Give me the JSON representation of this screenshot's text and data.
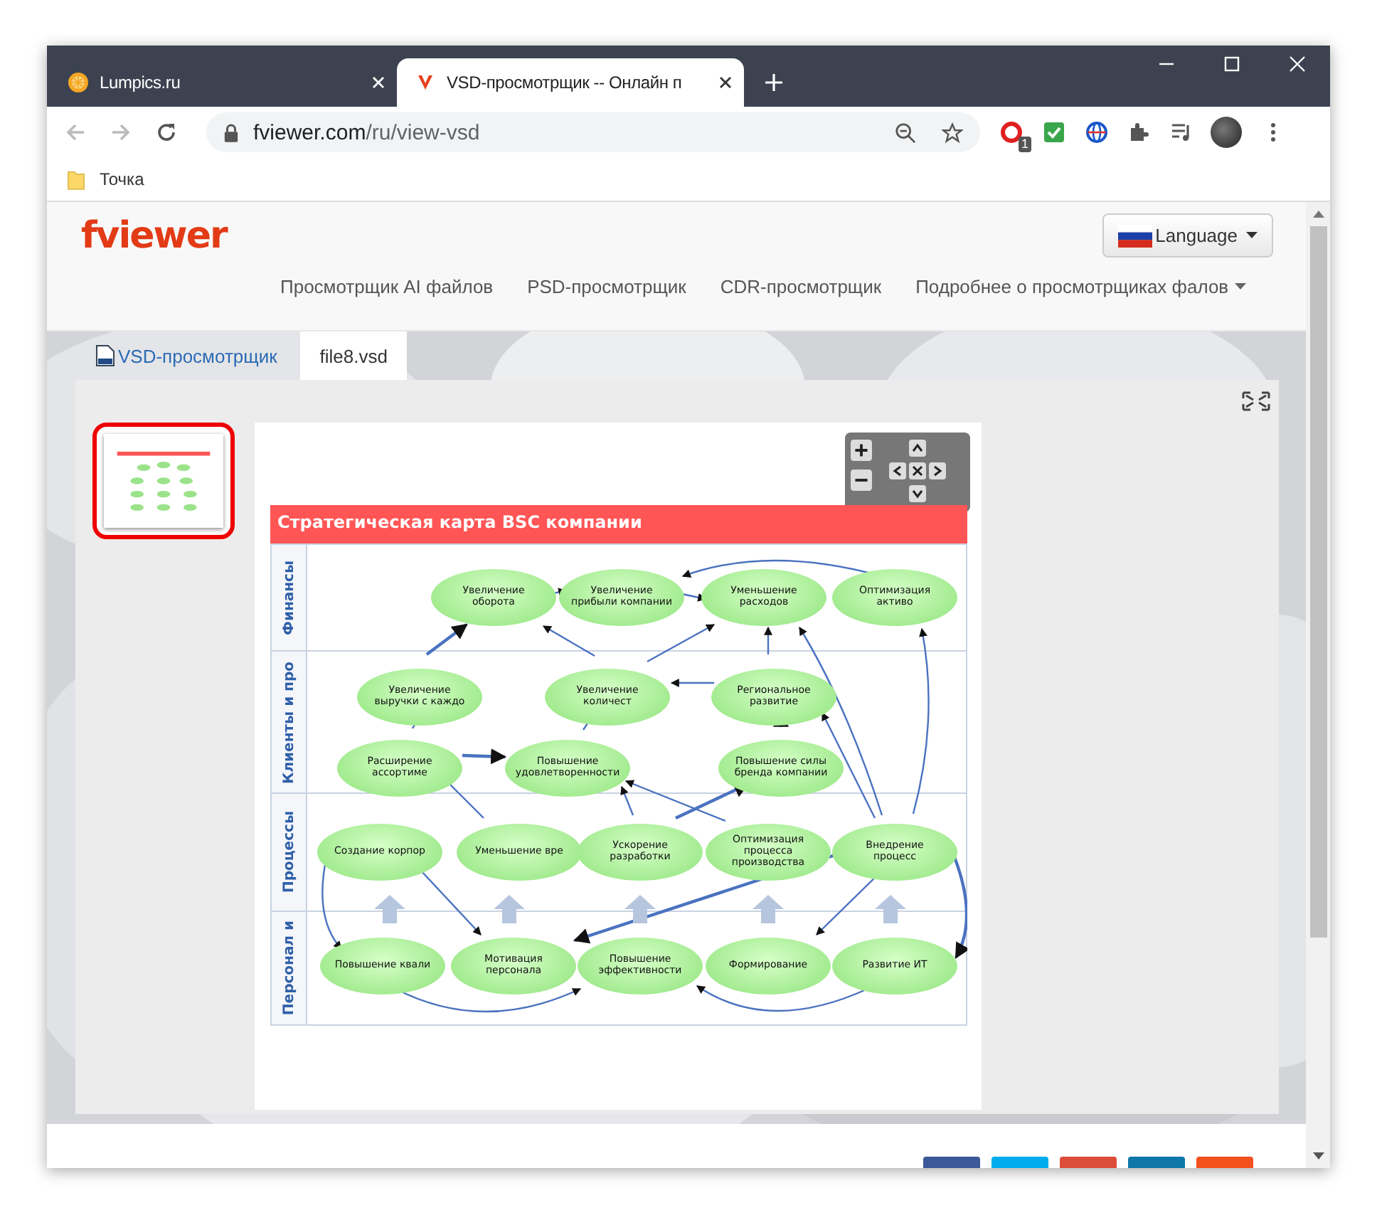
{
  "browser": {
    "tabs": [
      {
        "title": "Lumpics.ru",
        "kind": "fruit",
        "selected": false
      },
      {
        "title": "VSD-просмотрщик -- Онлайн п",
        "kind": "v-mark",
        "selected": true
      }
    ],
    "address": {
      "host": "fviewer.com",
      "path": "/ru/view-vsd"
    },
    "extension_badge": "1",
    "bookmarks": [
      {
        "label": "Точка"
      }
    ]
  },
  "site": {
    "logo": "fviewer",
    "language_button": "Language",
    "nav": [
      {
        "label": "Просмотрщик AI файлов",
        "has_menu": false
      },
      {
        "label": "PSD-просмотрщик",
        "has_menu": false
      },
      {
        "label": "CDR-просмотрщик",
        "has_menu": false
      },
      {
        "label": "Подробнее о просмотрщиках фалов",
        "has_menu": true
      }
    ]
  },
  "viewer_tabs": [
    {
      "label": "VSD-просмотрщик",
      "selected": false
    },
    {
      "label": "file8.vsd",
      "selected": true
    }
  ],
  "thumbnails": [
    {
      "selected": true
    }
  ],
  "diagram": {
    "title": "Стратегическая карта BSC компании",
    "lanes": [
      {
        "label": "Финансы",
        "rows": [
          [
            "Увеличение оборота",
            "Увеличение прибыли компании",
            "Уменьшение расходов",
            "Оптимизация активо"
          ]
        ]
      },
      {
        "label": "Клиенты и про",
        "rows": [
          [
            "Увеличение выручки с каждо",
            "Увеличение количест",
            "Региональное развитие"
          ],
          [
            "Расширение ассортиме",
            "Повышение удовлетворенности",
            "Повышение силы бренда компании"
          ]
        ]
      },
      {
        "label": "Процессы",
        "rows": [
          [
            "Создание корпор",
            "Уменьшение вре",
            "Ускорение разработки",
            "Оптимизация процесса производства",
            "Внедрение процесс"
          ]
        ]
      },
      {
        "label": "Персонал и",
        "rows": [
          [
            "Повышение квали",
            "Мотивация персонала",
            "Повышение эффективности",
            "Формирование",
            "Развитие ИТ"
          ]
        ]
      }
    ]
  },
  "share_buttons": [
    {
      "color": "#3b5998"
    },
    {
      "color": "#00aced"
    },
    {
      "color": "#dd4b39"
    },
    {
      "color": "#0e76a8"
    },
    {
      "color": "#f4511e"
    }
  ]
}
